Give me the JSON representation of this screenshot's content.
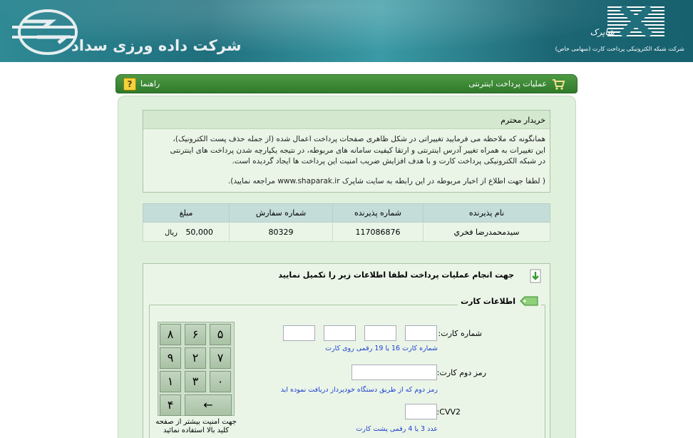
{
  "header": {
    "company_title": "شرکت داده ورزی سداد",
    "shaparak_name": "شاپرک",
    "shaparak_sub": "شرکت شبکه الکترونیکی پرداخت کارت (سهامی خاص)"
  },
  "titlebar": {
    "title": "عملیات پرداخت اینترنتی",
    "help_label": "راهنما"
  },
  "notice": {
    "heading": "خریدار محترم",
    "lines": [
      "همانگونه که ملاحظه می فرمایید تغییراتی در شکل ظاهری صفحات پرداخت اعمال شده (از جمله حذف پست الکترونیک)،",
      "این تغییرات به همراه تغییر آدرس اینترنتی و ارتقا کیفیت سامانه های مربوطه، در نتیجه یکپارچه شدن پرداخت های اینترنتی",
      "در شبکه الکترونیکی پرداخت کارت و با هدف افزایش ضریب امنیت این پرداخت ها ایجاد گردیده است."
    ],
    "footer": "( لطفا جهت اطلاع از اخبار مربوطه در این رابطه به سایت شاپرک www.shaparak.ir مراجعه نمایید)."
  },
  "order_table": {
    "headers": [
      "نام پذیرنده",
      "شماره پذیرنده",
      "شماره سفارش",
      "مبلغ"
    ],
    "row": {
      "merchant_name": "سیدمحمدرضا فخري",
      "merchant_number": "117086876",
      "order_number": "80329",
      "amount": "50,000",
      "currency": "ریال"
    }
  },
  "payment": {
    "instruction": "جهت انجام عملیات پرداخت لطفا اطلاعات زیر را تکمیل نمایید",
    "section_title": "اطلاعات کارت",
    "card_number_label": "شماره کارت:",
    "card_number_hint": "شماره کارت 16 یا 19 رقمی روی کارت",
    "pin2_label": "رمز دوم کارت:",
    "pin2_hint": "رمز دوم که از طریق دستگاه خودپرداز دریافت نموده اید",
    "cvv2_label": "CVV2:",
    "cvv2_hint": "عدد 3 یا 4 رقمی پشت کارت",
    "card_parts": [
      "",
      "",
      "",
      ""
    ],
    "pin2_value": "",
    "cvv2_value": ""
  },
  "keypad": {
    "keys": [
      "۵",
      "۶",
      "۸",
      "۷",
      "۲",
      "۹",
      "۰",
      "۳",
      "۱",
      "←",
      "۴"
    ],
    "note_line1": "جهت امنیت بیشتر از صفحه",
    "note_line2": "کلید بالا استفاده نمائید"
  },
  "colors": {
    "banner": "#1f6f7d",
    "titlebar": "#3a8a35",
    "panel": "#dff0dc",
    "hint_blue": "#1d3fd0"
  }
}
